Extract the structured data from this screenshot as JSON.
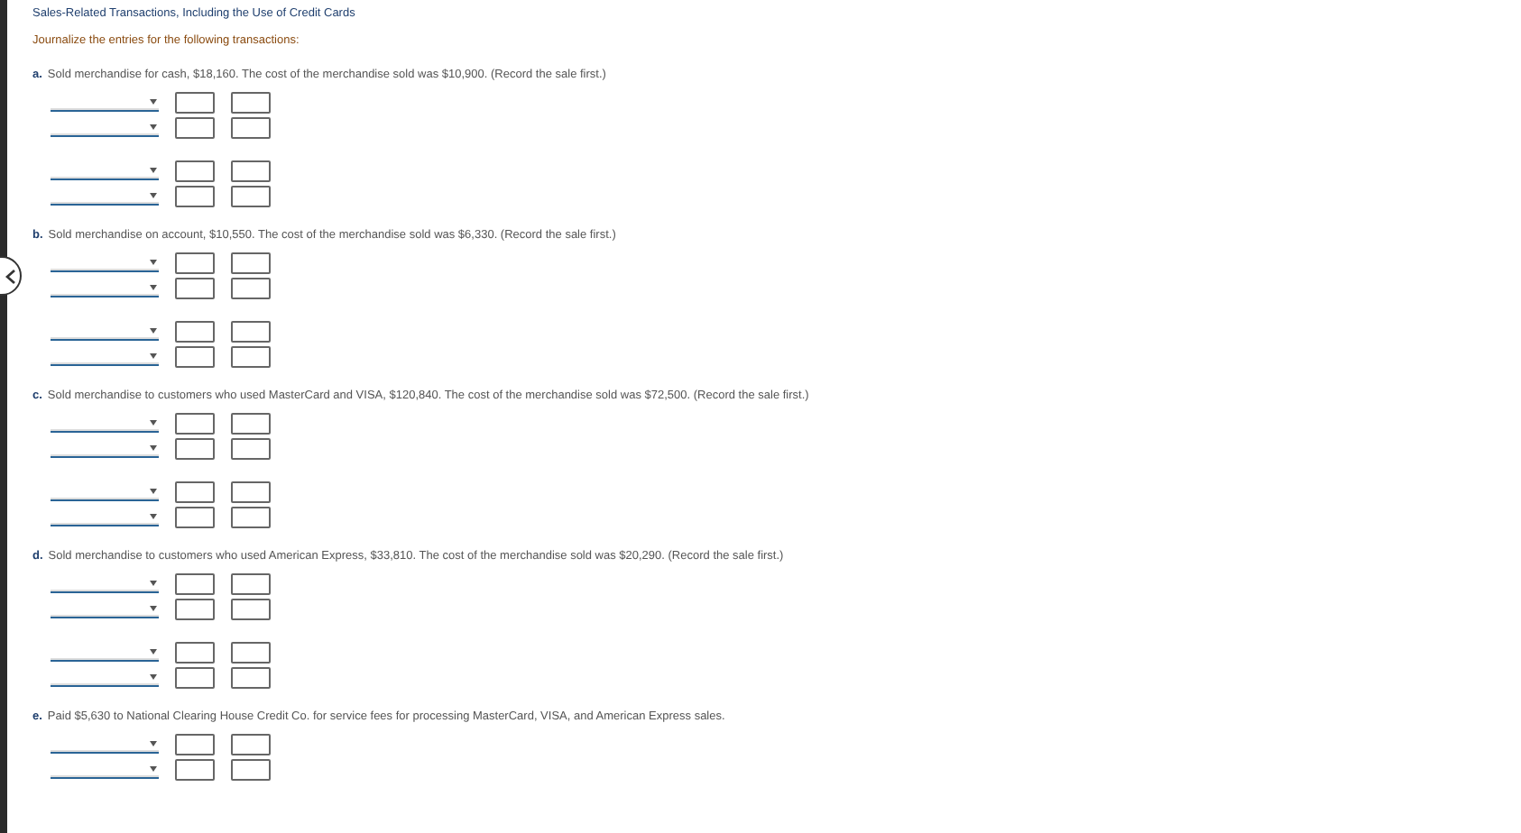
{
  "title": "Sales-Related Transactions, Including the Use of Credit Cards",
  "instruction": "Journalize the entries for the following transactions:",
  "sections": [
    {
      "label": "a.",
      "text": "Sold merchandise for cash, $18,160. The cost of the merchandise sold was $10,900. (Record the sale first.)",
      "entries": [
        {
          "lines": [
            {
              "kind": "journal-line"
            },
            {
              "kind": "journal-line"
            }
          ]
        },
        {
          "lines": [
            {
              "kind": "journal-line"
            },
            {
              "kind": "journal-line"
            }
          ]
        }
      ]
    },
    {
      "label": "b.",
      "text": "Sold merchandise on account, $10,550. The cost of the merchandise sold was $6,330. (Record the sale first.)",
      "entries": [
        {
          "lines": [
            {
              "kind": "journal-line"
            },
            {
              "kind": "journal-line"
            }
          ]
        },
        {
          "lines": [
            {
              "kind": "journal-line"
            },
            {
              "kind": "journal-line"
            }
          ]
        }
      ]
    },
    {
      "label": "c.",
      "text": "Sold merchandise to customers who used MasterCard and VISA, $120,840. The cost of the merchandise sold was $72,500. (Record the sale first.)",
      "entries": [
        {
          "lines": [
            {
              "kind": "journal-line"
            },
            {
              "kind": "journal-line"
            }
          ]
        },
        {
          "lines": [
            {
              "kind": "journal-line"
            },
            {
              "kind": "journal-line"
            }
          ]
        }
      ]
    },
    {
      "label": "d.",
      "text": "Sold merchandise to customers who used American Express, $33,810. The cost of the merchandise sold was $20,290. (Record the sale first.)",
      "entries": [
        {
          "lines": [
            {
              "kind": "journal-line"
            },
            {
              "kind": "journal-line"
            }
          ]
        },
        {
          "lines": [
            {
              "kind": "journal-line"
            },
            {
              "kind": "journal-line"
            }
          ]
        }
      ]
    },
    {
      "label": "e.",
      "text": "Paid $5,630 to National Clearing House Credit Co. for service fees for processing MasterCard, VISA, and American Express sales.",
      "entries": [
        {
          "lines": [
            {
              "kind": "journal-line"
            },
            {
              "kind": "journal-line"
            }
          ]
        }
      ]
    }
  ]
}
